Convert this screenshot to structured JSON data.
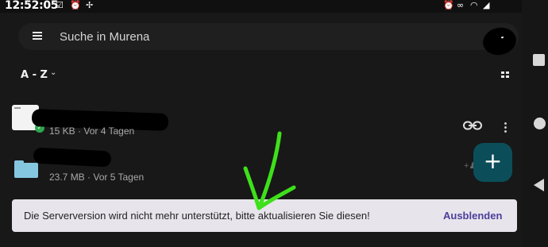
{
  "status_bar": {
    "time": "12:52:05",
    "left_icons": [
      "checkbox-icon",
      "alarm-icon",
      "fan-icon"
    ],
    "right_icons": [
      "alarm-icon",
      "link-icon",
      "wifi-icon",
      "signal-icon",
      "battery-icon"
    ]
  },
  "search": {
    "placeholder": "Suche in Murena"
  },
  "list_header": {
    "sort_label": "A - Z"
  },
  "files": [
    {
      "type": "file",
      "name": "",
      "meta": "15 KB · Vor 4 Tagen",
      "synced": true
    },
    {
      "type": "folder",
      "name": "",
      "meta": "23.7 MB · Vor 5 Tagen"
    }
  ],
  "fab": {
    "label": "+"
  },
  "snackbar": {
    "message": "Die Serverversion wird nicht mehr unterstützt, bitte aktualisieren Sie diesen!",
    "action": "Ausblenden"
  },
  "colors": {
    "background": "#181818",
    "fab": "#0b4e5a",
    "folder": "#86c7e0",
    "snackbar": "#e8e4ec",
    "snackbar_action": "#4a3f9a",
    "annotation_arrow": "#3ee01a"
  }
}
